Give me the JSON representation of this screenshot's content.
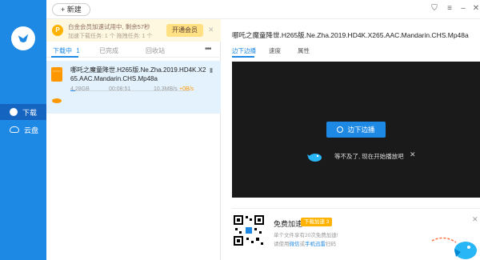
{
  "topbar": {
    "new_label": "+ 新建"
  },
  "sidebar": {
    "items": [
      {
        "label": "下载"
      },
      {
        "label": "云盘"
      }
    ]
  },
  "vip": {
    "badge": "P",
    "line1": "白金会员加速试用中, 剩余57秒",
    "line2": "加速下载任务: 1 个  拖拽任务: 1 个",
    "button": "开通会员",
    "close": "✕"
  },
  "tabs": {
    "downloading": "下载中",
    "downloading_count": "1",
    "completed": "已完成",
    "recycle": "回收站",
    "more": "•••"
  },
  "download": {
    "name": "哪吒之魔童降世.H265版.Ne.Zha.2019.HD4K.X265.AAC.Mandarin.CHS.Mp48a",
    "size": "4.28GB",
    "time": "00:08:51",
    "speed": "10.3MB/s",
    "speed_extra": "+0B/s",
    "progress": 0.04
  },
  "detail": {
    "title": "哪吒之魔童降世.H265版.Ne.Zha.2019.HD4K.X265.AAC.Mandarin.CHS.Mp48a",
    "tabs": [
      "边下边播",
      "速度",
      "属性"
    ]
  },
  "player": {
    "play_label": "边下边播",
    "hint": "等不及了, 现在开始播放吧",
    "hint_close": "✕"
  },
  "promo": {
    "title": "免费加速",
    "badge": "下载加速 3",
    "line1": "单个文件享有20次免费加速!",
    "line2_prefix": "请使用",
    "line2_link1": "微信",
    "line2_mid": "或",
    "line2_link2": "手机迅雷",
    "line2_suffix": "扫码",
    "close": "✕"
  },
  "colors": {
    "accent": "#1e88e5",
    "vip": "#ffb300"
  }
}
